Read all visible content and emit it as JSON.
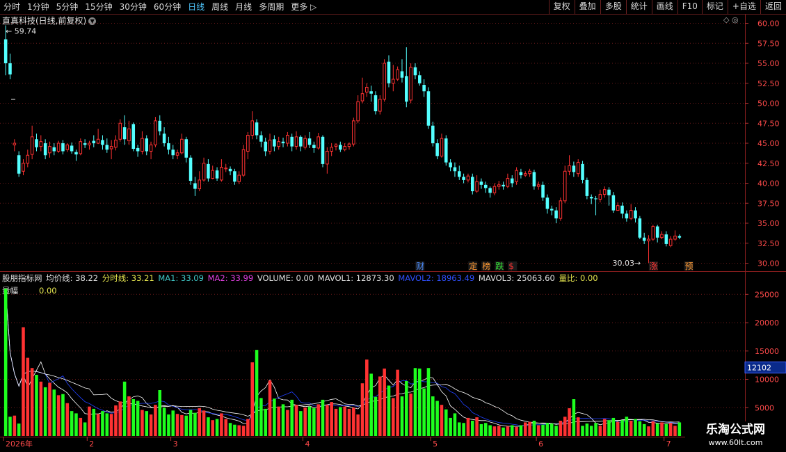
{
  "toolbar": {
    "periods": [
      "分时",
      "1分钟",
      "5分钟",
      "15分钟",
      "30分钟",
      "60分钟",
      "日线",
      "周线",
      "月线",
      "多周期",
      "更多"
    ],
    "active_period": "日线",
    "more_arrow": "▷",
    "right_buttons": [
      "复权",
      "叠加",
      "多股",
      "统计",
      "画线",
      "F10",
      "标记",
      "+自选",
      "返回"
    ]
  },
  "main_title": "直真科技(日线,前复权)",
  "chev_icon": "chevron-down-icon",
  "corner_icons": "◇ ◎",
  "price_axis": [
    "60.00",
    "57.50",
    "55.00",
    "52.50",
    "50.00",
    "47.50",
    "45.00",
    "42.50",
    "40.00",
    "37.50",
    "35.00",
    "32.50",
    "30.00"
  ],
  "high_marker": "59.74",
  "low_marker": "30.03",
  "event_tags": [
    {
      "text": "财",
      "color": "#4a8cff",
      "x_date": "4/30"
    },
    {
      "text": "定",
      "color": "#ff9933",
      "x_date": "5/12"
    },
    {
      "text": "榜",
      "color": "#ff9933",
      "x_date": "5/15"
    },
    {
      "text": "跌",
      "color": "#33dd33",
      "x_date": "5/18"
    },
    {
      "text": "$",
      "color": "#ff3333",
      "x_date": "5/20"
    },
    {
      "text": "涨",
      "color": "#ff3333",
      "x_date": "6/30"
    },
    {
      "text": "预",
      "color": "#ff9933",
      "x_date": "7/8"
    }
  ],
  "indicator": {
    "name": "股朋指标网",
    "items": [
      {
        "label": "均价线:",
        "value": "38.22",
        "color": "#e0e0e0"
      },
      {
        "label": "分时线:",
        "value": "33.21",
        "color": "#e8e850"
      },
      {
        "label": "MA1:",
        "value": "33.09",
        "color": "#40c8c8"
      },
      {
        "label": "MA2:",
        "value": "33.99",
        "color": "#e040e0"
      },
      {
        "label": "VOLUME:",
        "value": "0.00",
        "color": "#e0e0e0"
      },
      {
        "label": "MAVOL1:",
        "value": "12873.30",
        "color": "#e0e0e0"
      },
      {
        "label": "MAVOL2:",
        "value": "18963.49",
        "color": "#3050ff"
      },
      {
        "label": "MAVOL3:",
        "value": "25063.60",
        "color": "#e0e0e0"
      },
      {
        "label": "量比:",
        "value": "0.00",
        "color": "#e8e850"
      }
    ]
  },
  "sub_label": "量幅",
  "sub_value": "0.00",
  "volume_axis": [
    "25000",
    "20000",
    "15000",
    "10000",
    "5000"
  ],
  "volume_current": "12102",
  "date_axis": [
    {
      "label": "2026年",
      "idx": 0
    },
    {
      "label": "2",
      "idx": 19
    },
    {
      "label": "3",
      "idx": 38
    },
    {
      "label": "4",
      "idx": 68
    },
    {
      "label": "5",
      "idx": 97
    },
    {
      "label": "6",
      "idx": 121
    },
    {
      "label": "7",
      "idx": 150
    }
  ],
  "watermark": {
    "line1": "乐淘公式网",
    "line2": "www.60lt.com"
  },
  "chart_data": {
    "type": "candlestick",
    "title": "直真科技(日线,前复权)",
    "ylim": [
      29.0,
      61.0
    ],
    "volume_ylim": [
      0,
      27000
    ],
    "candles": [
      [
        58.0,
        55.0,
        59.74,
        53.5
      ],
      [
        55.0,
        53.6,
        56.2,
        53.0
      ],
      [
        44.8,
        45.0,
        45.5,
        44.0
      ],
      [
        43.5,
        41.2,
        44.0,
        40.8
      ],
      [
        41.5,
        42.5,
        43.0,
        41.0
      ],
      [
        42.5,
        43.5,
        44.2,
        42.0
      ],
      [
        43.6,
        45.8,
        47.2,
        43.0
      ],
      [
        45.5,
        44.5,
        46.2,
        44.0
      ],
      [
        44.6,
        45.2,
        46.0,
        44.0
      ],
      [
        45.0,
        43.5,
        45.5,
        43.0
      ],
      [
        43.8,
        44.6,
        45.2,
        43.2
      ],
      [
        44.5,
        44.0,
        45.0,
        43.5
      ],
      [
        44.0,
        45.0,
        45.3,
        43.8
      ],
      [
        45.0,
        44.0,
        45.4,
        43.6
      ],
      [
        44.2,
        44.8,
        45.0,
        43.9
      ],
      [
        44.7,
        44.0,
        45.1,
        43.7
      ],
      [
        43.9,
        43.6,
        44.2,
        42.8
      ],
      [
        43.7,
        45.2,
        45.6,
        43.5
      ],
      [
        45.0,
        44.8,
        45.5,
        44.4
      ],
      [
        44.8,
        45.0,
        45.3,
        44.2
      ],
      [
        45.3,
        45.0,
        46.0,
        44.5
      ],
      [
        45.0,
        45.5,
        46.8,
        44.9
      ],
      [
        45.4,
        44.8,
        46.0,
        44.2
      ],
      [
        44.8,
        44.2,
        45.6,
        43.8
      ],
      [
        44.3,
        44.6,
        45.4,
        43.0
      ],
      [
        44.5,
        45.4,
        46.0,
        44.1
      ],
      [
        45.5,
        47.5,
        48.0,
        45.2
      ],
      [
        47.0,
        45.5,
        48.5,
        44.8
      ],
      [
        45.3,
        46.8,
        47.8,
        44.8
      ],
      [
        47.4,
        44.3,
        47.6,
        44.0
      ],
      [
        44.4,
        44.0,
        44.8,
        43.3
      ],
      [
        44.0,
        45.6,
        46.5,
        43.6
      ],
      [
        45.6,
        44.0,
        46.0,
        43.5
      ],
      [
        44.0,
        44.8,
        45.2,
        43.0
      ],
      [
        44.8,
        47.8,
        48.3,
        44.5
      ],
      [
        47.8,
        46.5,
        48.5,
        46.0
      ],
      [
        46.2,
        45.0,
        47.0,
        44.6
      ],
      [
        45.0,
        44.2,
        45.8,
        43.6
      ],
      [
        44.2,
        43.5,
        44.8,
        43.0
      ],
      [
        43.5,
        43.8,
        44.2,
        43.0
      ],
      [
        43.8,
        45.5,
        46.2,
        43.6
      ],
      [
        45.5,
        43.2,
        45.8,
        42.6
      ],
      [
        43.2,
        40.3,
        43.5,
        39.8
      ],
      [
        40.0,
        39.3,
        40.8,
        38.4
      ],
      [
        39.3,
        40.4,
        41.5,
        39.0
      ],
      [
        40.4,
        42.5,
        43.2,
        40.2
      ],
      [
        42.4,
        40.6,
        43.0,
        40.2
      ],
      [
        40.6,
        41.6,
        42.2,
        40.5
      ],
      [
        41.6,
        40.6,
        42.0,
        40.3
      ],
      [
        40.4,
        42.0,
        43.0,
        40.2
      ],
      [
        41.8,
        41.9,
        42.4,
        41.4
      ],
      [
        41.8,
        41.5,
        42.1,
        41.0
      ],
      [
        41.5,
        40.2,
        41.8,
        39.8
      ],
      [
        40.2,
        41.0,
        41.5,
        39.9
      ],
      [
        41.0,
        44.2,
        44.8,
        40.8
      ],
      [
        44.0,
        46.0,
        46.4,
        43.0
      ],
      [
        46.0,
        47.8,
        49.0,
        45.5
      ],
      [
        47.6,
        46.0,
        48.0,
        45.5
      ],
      [
        46.0,
        45.2,
        46.5,
        44.5
      ],
      [
        45.2,
        44.0,
        45.7,
        43.4
      ],
      [
        44.0,
        45.4,
        46.2,
        43.6
      ],
      [
        45.5,
        44.6,
        46.0,
        44.0
      ],
      [
        44.6,
        45.2,
        45.8,
        44.2
      ],
      [
        45.2,
        45.0,
        45.7,
        44.5
      ],
      [
        45.0,
        46.0,
        46.4,
        44.6
      ],
      [
        45.8,
        44.6,
        46.2,
        44.0
      ],
      [
        44.6,
        45.8,
        46.5,
        44.2
      ],
      [
        45.8,
        44.6,
        46.0,
        44.0
      ],
      [
        44.5,
        45.6,
        46.0,
        44.2
      ],
      [
        45.6,
        44.8,
        46.4,
        44.4
      ],
      [
        44.8,
        44.4,
        45.2,
        43.8
      ],
      [
        44.4,
        45.8,
        46.3,
        44.2
      ],
      [
        45.8,
        42.4,
        46.0,
        42.0
      ],
      [
        42.4,
        44.0,
        44.5,
        41.2
      ],
      [
        44.0,
        44.5,
        45.0,
        43.4
      ],
      [
        44.6,
        44.8,
        45.0,
        44.1
      ],
      [
        44.8,
        44.2,
        45.2,
        43.9
      ],
      [
        44.2,
        44.6,
        45.0,
        44.0
      ],
      [
        44.6,
        44.9,
        45.1,
        44.2
      ],
      [
        44.9,
        47.8,
        48.2,
        44.6
      ],
      [
        47.8,
        50.2,
        51.0,
        47.5
      ],
      [
        50.3,
        51.2,
        53.2,
        50.0
      ],
      [
        51.4,
        52.0,
        52.5,
        50.8
      ],
      [
        51.5,
        51.2,
        52.2,
        50.2
      ],
      [
        51.0,
        49.0,
        51.5,
        48.6
      ],
      [
        49.0,
        50.5,
        51.0,
        48.6
      ],
      [
        50.5,
        55.0,
        55.5,
        50.2
      ],
      [
        55.2,
        52.5,
        56.0,
        52.0
      ],
      [
        52.5,
        53.0,
        54.8,
        51.5
      ],
      [
        53.0,
        54.2,
        54.6,
        52.8
      ],
      [
        54.0,
        53.2,
        55.5,
        52.6
      ],
      [
        53.4,
        50.2,
        57.0,
        49.5
      ],
      [
        50.4,
        54.5,
        55.0,
        50.0
      ],
      [
        54.5,
        53.5,
        55.0,
        53.0
      ],
      [
        53.5,
        52.5,
        54.0,
        52.2
      ],
      [
        52.3,
        51.5,
        53.0,
        50.8
      ],
      [
        51.5,
        47.2,
        52.0,
        46.8
      ],
      [
        47.2,
        45.0,
        47.7,
        44.6
      ],
      [
        45.0,
        43.4,
        45.5,
        43.0
      ],
      [
        43.4,
        45.6,
        46.2,
        43.2
      ],
      [
        45.6,
        42.6,
        46.0,
        42.2
      ],
      [
        42.6,
        42.0,
        43.0,
        41.5
      ],
      [
        42.0,
        41.5,
        42.6,
        40.8
      ],
      [
        41.5,
        40.8,
        42.2,
        40.4
      ],
      [
        40.8,
        40.4,
        41.2,
        40.0
      ],
      [
        40.4,
        40.9,
        41.2,
        40.1
      ],
      [
        40.8,
        39.0,
        41.2,
        38.6
      ],
      [
        39.0,
        40.2,
        41.0,
        38.8
      ],
      [
        40.2,
        39.8,
        40.6,
        39.3
      ],
      [
        39.8,
        39.4,
        40.2,
        38.8
      ],
      [
        39.4,
        38.8,
        39.6,
        38.2
      ],
      [
        38.8,
        39.6,
        40.0,
        38.5
      ],
      [
        39.6,
        39.8,
        40.3,
        39.2
      ],
      [
        39.8,
        39.6,
        40.2,
        39.2
      ],
      [
        39.6,
        40.6,
        41.2,
        39.4
      ],
      [
        40.6,
        40.0,
        41.0,
        39.5
      ],
      [
        40.2,
        41.6,
        42.0,
        39.8
      ],
      [
        41.4,
        41.0,
        41.8,
        40.6
      ],
      [
        41.0,
        41.2,
        41.5,
        40.8
      ],
      [
        41.2,
        41.5,
        41.8,
        40.8
      ],
      [
        41.4,
        39.6,
        41.7,
        39.2
      ],
      [
        39.6,
        39.8,
        40.2,
        39.2
      ],
      [
        39.8,
        38.2,
        40.2,
        37.8
      ],
      [
        38.2,
        36.8,
        38.6,
        36.2
      ],
      [
        36.8,
        36.6,
        37.2,
        36.0
      ],
      [
        36.6,
        35.6,
        37.0,
        35.0
      ],
      [
        35.6,
        37.8,
        38.2,
        35.3
      ],
      [
        37.8,
        41.5,
        42.2,
        37.5
      ],
      [
        41.5,
        42.2,
        43.5,
        41.0
      ],
      [
        42.2,
        41.4,
        42.7,
        40.8
      ],
      [
        41.2,
        42.6,
        43.0,
        40.8
      ],
      [
        42.4,
        40.4,
        42.8,
        40.0
      ],
      [
        40.4,
        38.4,
        40.7,
        38.0
      ],
      [
        38.3,
        38.1,
        38.6,
        37.4
      ],
      [
        38.1,
        38.0,
        38.4,
        36.0
      ],
      [
        38.0,
        38.6,
        39.2,
        37.6
      ],
      [
        38.6,
        39.2,
        39.6,
        38.2
      ],
      [
        39.2,
        38.5,
        39.5,
        37.2
      ],
      [
        38.5,
        36.6,
        38.9,
        36.3
      ],
      [
        36.6,
        37.2,
        37.6,
        36.6
      ],
      [
        37.2,
        36.2,
        37.6,
        35.6
      ],
      [
        36.2,
        35.6,
        36.6,
        35.2
      ],
      [
        35.6,
        36.6,
        37.4,
        35.4
      ],
      [
        36.6,
        35.6,
        37.0,
        35.1
      ],
      [
        35.6,
        33.2,
        35.9,
        33.0
      ],
      [
        33.2,
        32.8,
        33.8,
        32.4
      ],
      [
        32.8,
        33.0,
        33.5,
        30.03
      ],
      [
        33.0,
        34.6,
        34.8,
        32.8
      ],
      [
        34.6,
        33.2,
        34.8,
        32.6
      ],
      [
        33.2,
        33.6,
        34.0,
        33.0
      ],
      [
        33.6,
        32.4,
        34.0,
        32.1
      ],
      [
        32.2,
        33.0,
        33.4,
        32.0
      ],
      [
        33.0,
        33.4,
        34.1,
        32.8
      ],
      [
        33.4,
        33.2,
        33.6,
        33.0
      ]
    ],
    "volumes": [
      26000,
      3400,
      3600,
      2200,
      19200,
      13800,
      12000,
      10800,
      9600,
      8600,
      9400,
      8200,
      7200,
      7400,
      5800,
      4400,
      4000,
      3200,
      2400,
      5200,
      4800,
      3900,
      4400,
      4000,
      3900,
      5400,
      6100,
      9600,
      7000,
      6500,
      6200,
      4600,
      4400,
      3800,
      5500,
      8100,
      5000,
      3800,
      4500,
      3900,
      3700,
      3600,
      4600,
      4100,
      4900,
      4500,
      3300,
      2800,
      3000,
      4000,
      3000,
      2300,
      2000,
      1900,
      1800,
      3000,
      13000,
      15200,
      6700,
      4800,
      9800,
      6600,
      5200,
      5600,
      4600,
      6400,
      5500,
      4400,
      5000,
      5200,
      4900,
      5600,
      6400,
      5500,
      6000,
      4800,
      5100,
      5200,
      4800,
      5000,
      3800,
      9300,
      13500,
      11000,
      6900,
      10500,
      11900,
      8900,
      6700,
      11700,
      7000,
      9700,
      7500,
      12000,
      11900,
      8400,
      12000,
      7000,
      6200,
      5500,
      4700,
      3200,
      4000,
      2400,
      2300,
      3200,
      2700,
      3300,
      2100,
      2300,
      1900,
      1700,
      1800,
      1500,
      1700,
      1900,
      1600,
      1900,
      2400,
      2500,
      2700,
      1900,
      2000,
      2300,
      2200,
      1800,
      2700,
      3400,
      4900,
      6500,
      3300,
      1800,
      2200,
      1800,
      2300,
      1800,
      3000,
      2800,
      3200,
      2500,
      2800,
      3400,
      2700,
      3000,
      2600,
      2100,
      1700,
      2600,
      2200,
      2400,
      2100,
      2300,
      1800,
      2400
    ]
  }
}
